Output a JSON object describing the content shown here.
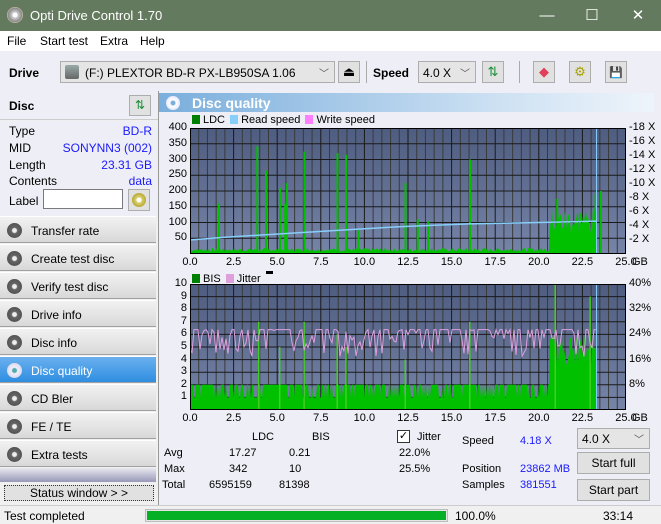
{
  "window": {
    "title": "Opti Drive Control 1.70",
    "minimize": "—",
    "maximize": "☐",
    "close": "✕"
  },
  "menu": {
    "file": "File",
    "start_test": "Start test",
    "extra": "Extra",
    "help": "Help"
  },
  "toolbar": {
    "drive_label": "Drive",
    "drive_value": "(F:)  PLEXTOR BD-R  PX-LB950SA 1.06",
    "speed_label": "Speed",
    "speed_value": "4.0 X",
    "eject_glyph": "⏏",
    "refresh_glyph": "⇅",
    "erase_glyph": "◆",
    "settings_glyph": "⚙",
    "save_glyph": "💾"
  },
  "disc": {
    "title": "Disc",
    "refresh_glyph": "⇅",
    "fields": [
      {
        "key": "Type",
        "value": "BD-R"
      },
      {
        "key": "MID",
        "value": "SONYNN3 (002)"
      },
      {
        "key": "Length",
        "value": "23.31 GB"
      },
      {
        "key": "Contents",
        "value": "data"
      }
    ],
    "label_key": "Label",
    "label_value": ""
  },
  "nav": {
    "items": [
      {
        "label": "Transfer rate"
      },
      {
        "label": "Create test disc"
      },
      {
        "label": "Verify test disc"
      },
      {
        "label": "Drive info"
      },
      {
        "label": "Disc info"
      },
      {
        "label": "Disc quality",
        "active": true
      },
      {
        "label": "CD Bler"
      },
      {
        "label": "FE / TE"
      },
      {
        "label": "Extra tests"
      }
    ],
    "status_window": "Status window > >"
  },
  "panel": {
    "title": "Disc quality"
  },
  "chart_data": [
    {
      "type": "bar",
      "title": "LDC / Read speed",
      "legend": [
        "LDC",
        "Read speed",
        "Write speed"
      ],
      "legend_colors": [
        "#008000",
        "#87cefa",
        "#ff80ff"
      ],
      "legend_placement": "top-left",
      "xlabel": "GB",
      "x_ticks": [
        "0.0",
        "2.5",
        "5.0",
        "7.5",
        "10.0",
        "12.5",
        "15.0",
        "17.5",
        "20.0",
        "22.5",
        "25.0"
      ],
      "xlim": [
        0,
        25
      ],
      "y_left_ticks": [
        "400",
        "350",
        "300",
        "250",
        "200",
        "150",
        "100",
        "50"
      ],
      "ylim_left": [
        0,
        400
      ],
      "y_right_ticks": [
        "18 X",
        "16 X",
        "14 X",
        "12 X",
        "10 X",
        "8 X",
        "6 X",
        "4 X",
        "2 X"
      ],
      "ylim_right": [
        0,
        18
      ],
      "grid": true,
      "ldc_baseline": 15,
      "ldc_spikes": [
        [
          1.6,
          160
        ],
        [
          3.8,
          342
        ],
        [
          4.3,
          265
        ],
        [
          5.1,
          210
        ],
        [
          5.4,
          160
        ],
        [
          5.5,
          225
        ],
        [
          6.5,
          325
        ],
        [
          8.4,
          320
        ],
        [
          8.9,
          315
        ],
        [
          9.6,
          75
        ],
        [
          12.3,
          225
        ],
        [
          13.0,
          110
        ],
        [
          13.6,
          105
        ],
        [
          16.0,
          300
        ],
        [
          21.0,
          175
        ],
        [
          22.3,
          130
        ],
        [
          23.2,
          190
        ],
        [
          23.5,
          200
        ]
      ],
      "ldc_high_region": {
        "from": 20.6,
        "to": 23.4,
        "level": 100
      },
      "read_speed": [
        [
          0,
          2.0
        ],
        [
          2,
          2.4
        ],
        [
          4,
          2.7
        ],
        [
          6,
          3.0
        ],
        [
          8,
          3.3
        ],
        [
          10,
          3.6
        ],
        [
          12,
          3.9
        ],
        [
          14,
          4.1
        ],
        [
          16,
          4.3
        ],
        [
          18,
          4.4
        ],
        [
          20,
          4.5
        ],
        [
          22,
          4.6
        ],
        [
          23.3,
          4.7
        ]
      ],
      "end_marker_gb": 23.31
    },
    {
      "type": "bar",
      "title": "BIS / Jitter",
      "legend": [
        "BIS",
        "Jitter"
      ],
      "legend_colors": [
        "#008000",
        "#dda0dd"
      ],
      "legend_placement": "top-left",
      "xlabel": "GB",
      "x_ticks": [
        "0.0",
        "2.5",
        "5.0",
        "7.5",
        "10.0",
        "12.5",
        "15.0",
        "17.5",
        "20.0",
        "22.5",
        "25.0"
      ],
      "xlim": [
        0,
        25
      ],
      "y_left_ticks": [
        "10",
        "9",
        "8",
        "7",
        "6",
        "5",
        "4",
        "3",
        "2",
        "1"
      ],
      "ylim_left": [
        0,
        10
      ],
      "y_right_ticks": [
        "40%",
        "32%",
        "24%",
        "16%",
        "8%"
      ],
      "ylim_right": [
        0,
        40
      ],
      "grid": true,
      "bis_level": 2,
      "bis_spikes": [
        [
          3.9,
          7
        ],
        [
          5.1,
          5
        ],
        [
          6.5,
          7
        ],
        [
          8.4,
          6
        ],
        [
          8.9,
          5
        ],
        [
          12.3,
          4
        ],
        [
          16.0,
          7
        ],
        [
          20.9,
          10
        ],
        [
          22.9,
          9
        ]
      ],
      "bis_high_region": {
        "from": 20.6,
        "to": 23.4,
        "level": 6
      },
      "jitter_range": [
        17,
        25.5
      ],
      "end_marker_gb": 23.31
    }
  ],
  "stats": {
    "col_ldc": "LDC",
    "col_bis": "BIS",
    "jitter_label": "Jitter",
    "jitter_checked": true,
    "rows": [
      {
        "label": "Avg",
        "ldc": "17.27",
        "bis": "0.21",
        "jitter": "22.0%"
      },
      {
        "label": "Max",
        "ldc": "342",
        "bis": "10",
        "jitter": "25.5%"
      },
      {
        "label": "Total",
        "ldc": "6595159",
        "bis": "81398",
        "jitter": ""
      }
    ],
    "speed_label": "Speed",
    "speed_value": "4.18 X",
    "position_label": "Position",
    "position_value": "23862 MB",
    "samples_label": "Samples",
    "samples_value": "381551",
    "speed_select": "4.0 X",
    "start_full": "Start full",
    "start_part": "Start part"
  },
  "statusbar": {
    "text": "Test completed",
    "progress": 100.0,
    "progress_text": "100.0%",
    "time": "33:14"
  }
}
